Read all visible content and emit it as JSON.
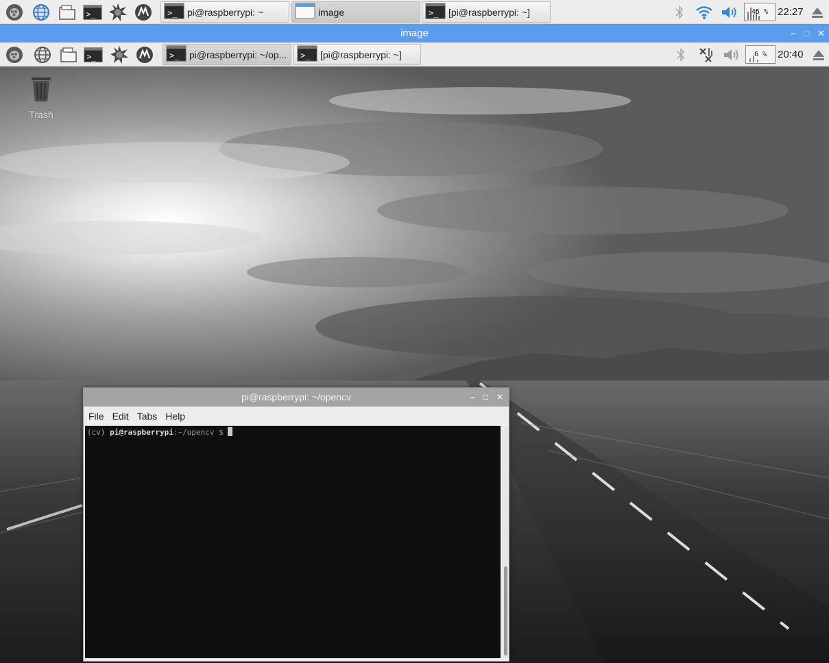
{
  "outer_taskbar": {
    "launchers": [
      {
        "icon": "raspberry-menu-icon"
      },
      {
        "icon": "web-browser-icon"
      },
      {
        "icon": "file-manager-icon"
      },
      {
        "icon": "terminal-icon"
      },
      {
        "icon": "math-kernel-icon"
      },
      {
        "icon": "wolfram-icon"
      }
    ],
    "tasks": [
      {
        "label": "pi@raspberrypi: ~",
        "icon": "terminal-icon",
        "active": false
      },
      {
        "label": "image",
        "icon": "window-icon",
        "active": true
      },
      {
        "label": "[pi@raspberrypi: ~]",
        "icon": "terminal-icon",
        "active": false
      }
    ],
    "tray": {
      "bluetooth_icon": "bluetooth-icon",
      "wifi_icon": "wifi-icon",
      "volume_icon": "volume-icon",
      "cpu_percent": "45",
      "cpu_unit": "%",
      "clock": "22:27",
      "eject_icon": "eject-icon"
    }
  },
  "vnc_window": {
    "title": "image",
    "controls": {
      "minimize": "–",
      "maximize": "□",
      "close": "✕"
    }
  },
  "remote_taskbar": {
    "tasks": [
      {
        "label": "pi@raspberrypi: ~/op...",
        "icon": "terminal-icon",
        "active": true
      },
      {
        "label": "[pi@raspberrypi: ~]",
        "icon": "terminal-icon",
        "active": false
      }
    ],
    "tray": {
      "cpu_percent": "6",
      "cpu_unit": "%",
      "clock": "20:40"
    }
  },
  "desktop": {
    "icons": [
      {
        "label": "Trash",
        "icon": "trash-icon"
      }
    ]
  },
  "terminal": {
    "title": "pi@raspberrypi: ~/opencv",
    "controls": {
      "minimize": "–",
      "maximize": "□",
      "close": "✕"
    },
    "menu": [
      "File",
      "Edit",
      "Tabs",
      "Help"
    ],
    "prompt": {
      "env": "(cv) ",
      "user_host": "pi@raspberrypi",
      "path": ":~/opencv $ "
    }
  },
  "colors": {
    "vnc_title_bg": "#5c9ced",
    "terminal_title_bg": "#a3a3a3",
    "terminal_bg": "#0f0f0f"
  }
}
